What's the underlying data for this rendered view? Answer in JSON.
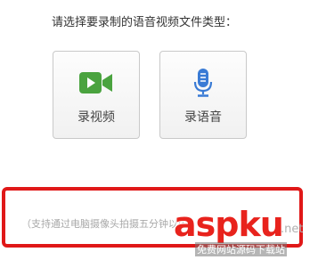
{
  "prompt": "请选择要录制的语音视频文件类型：",
  "buttons": [
    {
      "label": "录视频",
      "icon": "video-camera-icon",
      "color": "#4aa33f"
    },
    {
      "label": "录语音",
      "icon": "microphone-icon",
      "color": "#3a7bd5"
    }
  ],
  "hint": "（支持通过电脑摄像头拍摄五分钟以内",
  "highlight_color": "#e01818",
  "watermark": {
    "main": "aspku",
    "domain": ".net",
    "slogan": "免费网站源码下载站"
  }
}
